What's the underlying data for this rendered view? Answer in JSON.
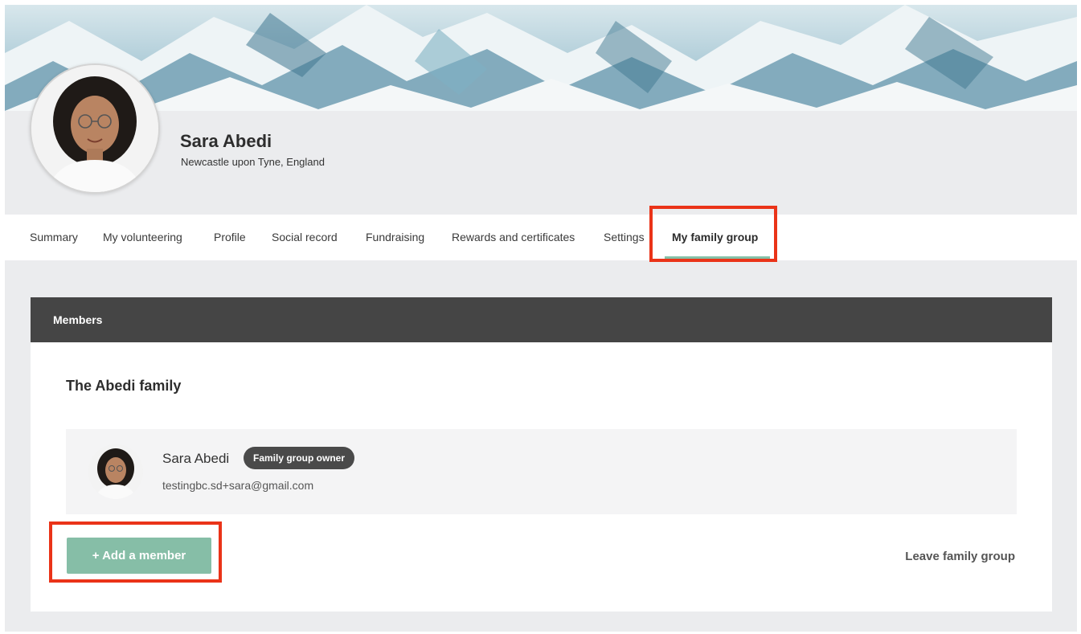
{
  "profile": {
    "name": "Sara Abedi",
    "location": "Newcastle upon Tyne, England"
  },
  "tabs": [
    {
      "label": "Summary",
      "active": false
    },
    {
      "label": "My volunteering",
      "active": false
    },
    {
      "label": "Profile",
      "active": false
    },
    {
      "label": "Social record",
      "active": false
    },
    {
      "label": "Fundraising",
      "active": false
    },
    {
      "label": "Rewards and certificates",
      "active": false
    },
    {
      "label": "Settings",
      "active": false
    },
    {
      "label": "My family group",
      "active": true
    }
  ],
  "members_card": {
    "title": "Members",
    "family_name": "The Abedi family",
    "members": [
      {
        "name": "Sara Abedi",
        "badge": "Family group owner",
        "email": "testingbc.sd+sara@gmail.com"
      }
    ],
    "add_button_label": "+ Add a member",
    "leave_label": "Leave family group"
  },
  "colors": {
    "accent": "#85c0a7",
    "highlight": "#ea3318",
    "card_header": "#454545"
  },
  "icons": {
    "profile_photo": "avatar-photo",
    "banner": "mountain-snow-banner"
  }
}
